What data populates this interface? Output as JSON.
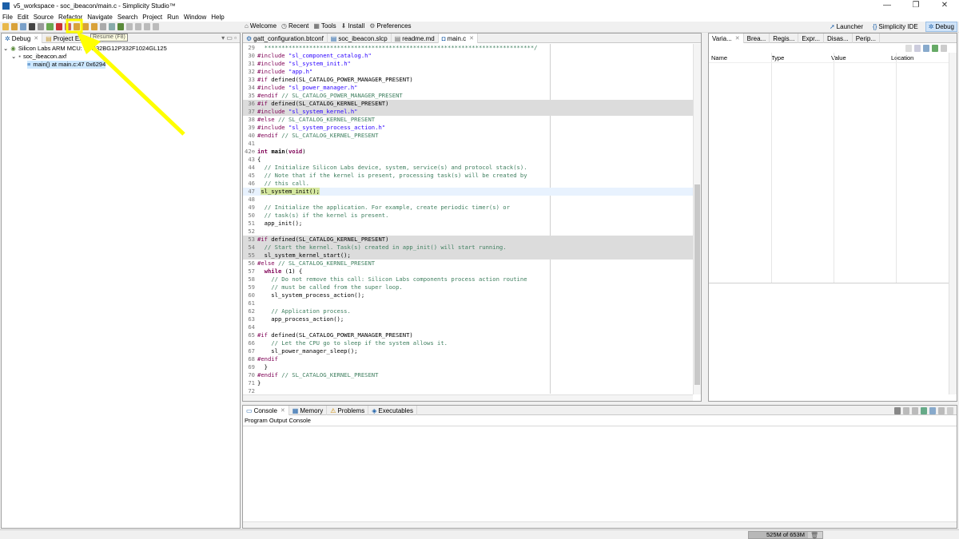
{
  "window": {
    "title": "v5_workspace - soc_ibeacon/main.c - Simplicity Studio™",
    "controls": [
      "—",
      "❐",
      "✕"
    ]
  },
  "menu": [
    "File",
    "Edit",
    "Source",
    "Refactor",
    "Navigate",
    "Search",
    "Project",
    "Run",
    "Window",
    "Help"
  ],
  "quicklinks": [
    {
      "icon": "home-icon",
      "label": "Welcome"
    },
    {
      "icon": "clock-icon",
      "label": "Recent"
    },
    {
      "icon": "grid-icon",
      "label": "Tools"
    },
    {
      "icon": "install-icon",
      "label": "Install"
    },
    {
      "icon": "gear-icon",
      "label": "Preferences"
    }
  ],
  "perspectives": [
    {
      "label": "Launcher",
      "active": false
    },
    {
      "label": "Simplicity IDE",
      "active": false
    },
    {
      "label": "Debug",
      "active": true
    }
  ],
  "tooltip": "Resume (F8)",
  "left_panel": {
    "tabs": [
      "Debug",
      "Project Explorer"
    ],
    "tree": [
      "Silicon Labs ARM MCU: EFR32BG12P332F1024GL125",
      "soc_ibeacon.axf",
      "main() at main.c:47 0x6294"
    ]
  },
  "editor": {
    "tabs": [
      {
        "label": "gatt_configuration.btconf",
        "active": false
      },
      {
        "label": "soc_ibeacon.slcp",
        "active": false
      },
      {
        "label": "readme.md",
        "active": false
      },
      {
        "label": "main.c",
        "active": true
      }
    ]
  },
  "right_panel": {
    "tabs": [
      "Varia...",
      "Brea...",
      "Regis...",
      "Expr...",
      "Disas...",
      "Perip..."
    ],
    "columns": [
      "Name",
      "Type",
      "Value",
      "Location"
    ]
  },
  "console": {
    "tabs": [
      "Console",
      "Memory",
      "Problems",
      "Executables"
    ],
    "title": "Program Output Console"
  },
  "status": {
    "memory": "525M of 653M",
    "memory_fraction": 0.8
  },
  "colors": {
    "accent": "#1b5fa8",
    "highlight": "#ffff00"
  }
}
